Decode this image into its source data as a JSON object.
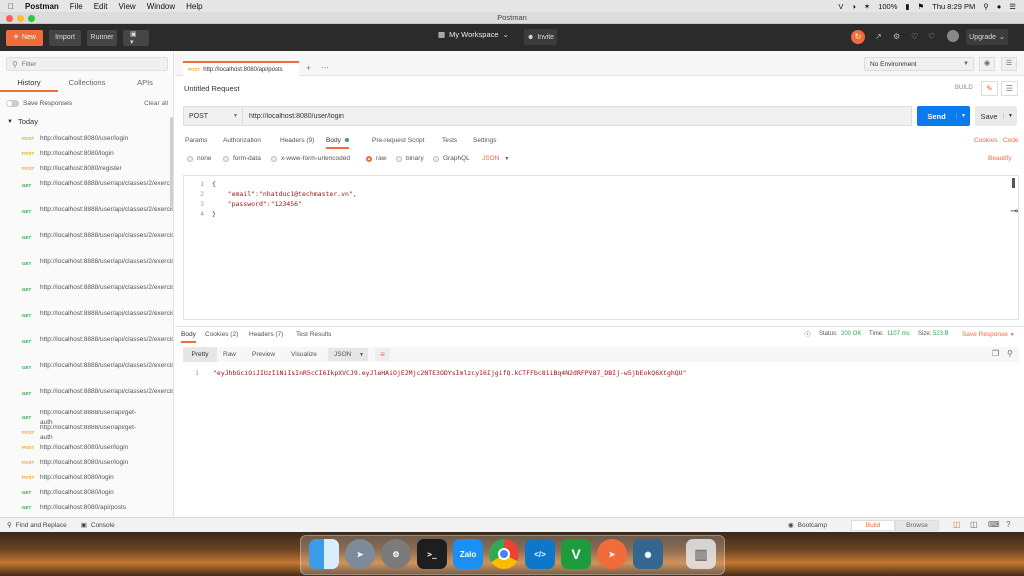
{
  "menubar": {
    "app": "Postman",
    "items": [
      "File",
      "Edit",
      "View",
      "Window",
      "Help"
    ],
    "battery": "100%",
    "clock": "Thu 8:29 PM"
  },
  "window": {
    "title": "Postman"
  },
  "toolbar": {
    "new_label": "New",
    "import_label": "Import",
    "runner_label": "Runner",
    "workspace_label": "My Workspace",
    "invite_label": "Invite",
    "upgrade_label": "Upgrade"
  },
  "sidebar": {
    "filter_placeholder": "Filter",
    "tabs": [
      "History",
      "Collections",
      "APIs"
    ],
    "save_responses": "Save Responses",
    "clear_all": "Clear all",
    "group": "Today",
    "history": [
      {
        "method": "POST",
        "url": "http://localhost:8080/user/login"
      },
      {
        "method": "POST",
        "url": "http://localhost:8080/login"
      },
      {
        "method": "POST",
        "url": "http://localhost:8080/register"
      },
      {
        "method": "GET",
        "url": "http://localhost:8888/user/api/classes/2/exercises"
      },
      {
        "method": "GET",
        "url": "http://localhost:8888/user/api/classes/2/exercises"
      },
      {
        "method": "GET",
        "url": "http://localhost:8888/user/api/classes/2/exercises"
      },
      {
        "method": "GET",
        "url": "http://localhost:8888/user/api/classes/2/exercises"
      },
      {
        "method": "GET",
        "url": "http://localhost:8888/user/api/classes/2/exercises"
      },
      {
        "method": "GET",
        "url": "http://localhost:8888/user/api/classes/2/exercises"
      },
      {
        "method": "GET",
        "url": "http://localhost:8888/user/api/classes/2/exercises"
      },
      {
        "method": "GET",
        "url": "http://localhost:8888/user/api/classes/2/exercises"
      },
      {
        "method": "GET",
        "url": "http://localhost:8888/user/api/classes/2/exercises"
      },
      {
        "method": "GET",
        "url": "http://localhost:8888/user/api/get-auth"
      },
      {
        "method": "POST",
        "url": "http://localhost:8888/user/api/get-auth"
      },
      {
        "method": "POST",
        "url": "http://localhost:8080/user/login"
      },
      {
        "method": "POST",
        "url": "http://localhost:8080/user/login"
      },
      {
        "method": "POST",
        "url": "http://localhost:8080/login"
      },
      {
        "method": "GET",
        "url": "http://localhost:8080/login"
      },
      {
        "method": "GET",
        "url": "http://localhost:8080/api/posts"
      }
    ]
  },
  "tabbar": {
    "tab_method": "POST",
    "tab_url": "http://localhost:8080/api/posts",
    "environment": "No Environment"
  },
  "request": {
    "name": "Untitled Request",
    "build_label": "BUILD",
    "method": "POST",
    "url": "http://localhost:8080/user/login",
    "send_label": "Send",
    "save_label": "Save",
    "tabs": [
      "Params",
      "Authorization",
      "Headers (9)",
      "Body",
      "Pre-request Script",
      "Tests",
      "Settings"
    ],
    "cookies": "Cookies",
    "code": "Code",
    "body_types": [
      "none",
      "form-data",
      "x-www-form-urlencoded",
      "raw",
      "binary",
      "GraphQL"
    ],
    "format": "JSON",
    "beautify": "Beautify",
    "body_lines": [
      "{",
      "    \"email\":\"nhatduc1@techmaster.vn\",",
      "    \"password\":\"123456\"",
      "}"
    ]
  },
  "response": {
    "tabs": [
      "Body",
      "Cookies (2)",
      "Headers (7)",
      "Test Results"
    ],
    "status_label": "Status:",
    "status_value": "200 OK",
    "time_label": "Time:",
    "time_value": "1107 ms",
    "size_label": "Size:",
    "size_value": "523 B",
    "save_response": "Save Response",
    "views": [
      "Pretty",
      "Raw",
      "Preview",
      "Visualize"
    ],
    "format": "JSON",
    "line": "\"eyJhbGciOiJIUzI1NiIsInR5cCI6IkpXVCJ9.eyJleHAiOjE2Mjc2NTE3ODYsImlzcyI6IjgifQ.kCTFFbc81iBq4N2dRFPV87_DBIj-w5jbEokQ6XtghQU\""
  },
  "statusbar": {
    "find_replace": "Find and Replace",
    "console": "Console",
    "bootcamp": "Bootcamp",
    "build": "Build",
    "browse": "Browse"
  },
  "dock": {
    "apps": [
      "Finder",
      "Launchpad",
      "System Preferences",
      "Terminal",
      "Zalo",
      "Chrome",
      "VS Code",
      "Vim",
      "Postman",
      "pgAdmin",
      "Trash"
    ]
  },
  "colors": {
    "accent": "#f26b3a",
    "send": "#097bed",
    "get": "#2fa84f",
    "post": "#f5a623",
    "status_ok": "#2fa84f"
  }
}
